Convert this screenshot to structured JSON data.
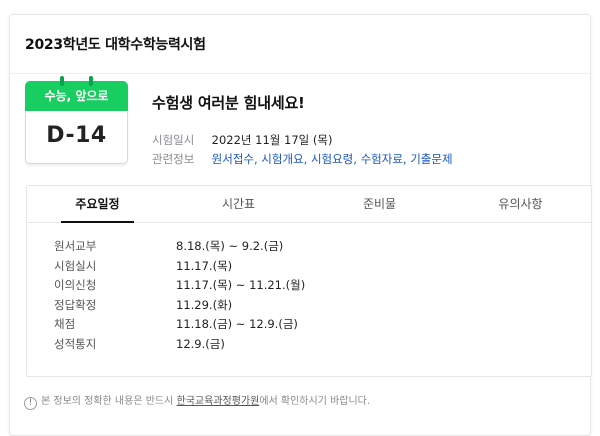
{
  "card": {
    "title": "2023학년도 대학수학능력시험"
  },
  "badge": {
    "top_label": "수능, 앞으로",
    "dday": "D-14",
    "accent": "#19ce60"
  },
  "headline": "수험생 여러분 힘내세요!",
  "exam_date": {
    "label": "시험일시",
    "value": "2022년 11월 17일 (목)"
  },
  "related": {
    "label": "관련정보",
    "links": [
      "원서접수",
      "시험개요",
      "시험요령",
      "수험자료",
      "기출문제"
    ]
  },
  "tabs": [
    {
      "label": "주요일정",
      "active": true
    },
    {
      "label": "시간표",
      "active": false
    },
    {
      "label": "준비물",
      "active": false
    },
    {
      "label": "유의사항",
      "active": false
    }
  ],
  "schedule": [
    {
      "item": "원서교부",
      "date": "8.18.(목) ~ 9.2.(금)"
    },
    {
      "item": "시험실시",
      "date": "11.17.(목)"
    },
    {
      "item": "이의신청",
      "date": "11.17.(목) ~ 11.21.(월)"
    },
    {
      "item": "정답확정",
      "date": "11.29.(화)"
    },
    {
      "item": "채점",
      "date": "11.18.(금) ~ 12.9.(금)"
    },
    {
      "item": "성적통지",
      "date": "12.9.(금)"
    }
  ],
  "notice": {
    "before": "본 정보의 정확한 내용은 반드시 ",
    "link": "한국교육과정평가원",
    "after": "에서 확인하시기 바랍니다."
  }
}
